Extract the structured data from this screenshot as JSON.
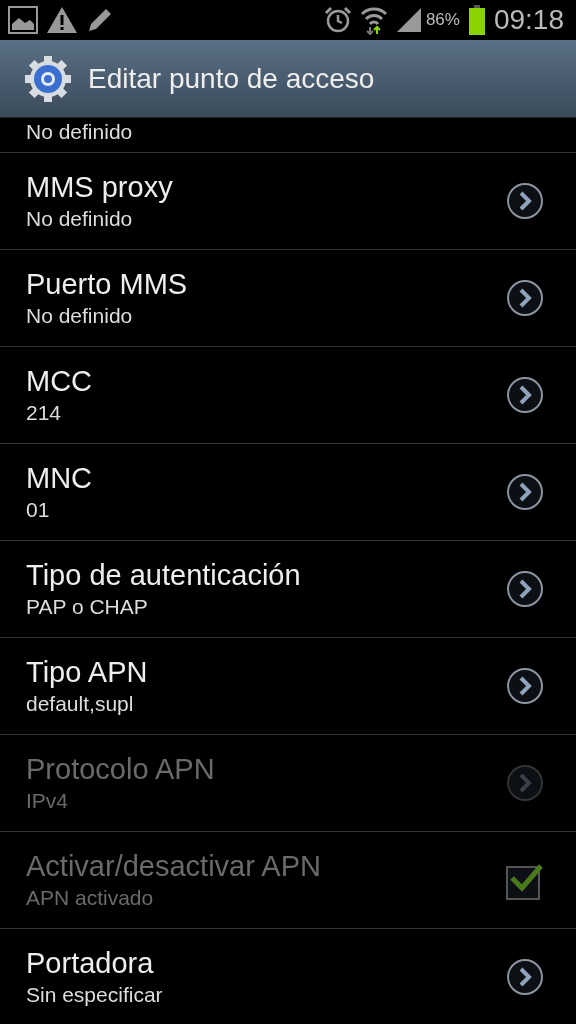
{
  "status_bar": {
    "battery_text": "86%",
    "time": "09:18"
  },
  "header": {
    "title": "Editar punto de acceso"
  },
  "partial_row": {
    "subtitle": "No definido"
  },
  "rows": [
    {
      "kind": "arrow",
      "title": "MMS proxy",
      "subtitle": "No definido",
      "disabled": false
    },
    {
      "kind": "arrow",
      "title": "Puerto MMS",
      "subtitle": "No definido",
      "disabled": false
    },
    {
      "kind": "arrow",
      "title": "MCC",
      "subtitle": "214",
      "disabled": false
    },
    {
      "kind": "arrow",
      "title": "MNC",
      "subtitle": "01",
      "disabled": false
    },
    {
      "kind": "arrow",
      "title": "Tipo de autenticación",
      "subtitle": "PAP o CHAP",
      "disabled": false
    },
    {
      "kind": "arrow",
      "title": "Tipo APN",
      "subtitle": "default,supl",
      "disabled": false
    },
    {
      "kind": "arrow",
      "title": "Protocolo APN",
      "subtitle": "IPv4",
      "disabled": true
    },
    {
      "kind": "checkbox",
      "title": "Activar/desactivar APN",
      "subtitle": "APN activado",
      "disabled": true,
      "checked": true
    },
    {
      "kind": "arrow",
      "title": "Portadora",
      "subtitle": "Sin especificar",
      "disabled": false
    }
  ]
}
